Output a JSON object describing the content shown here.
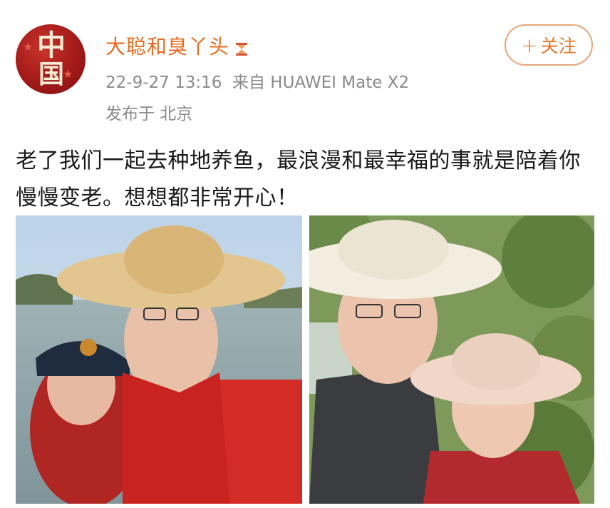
{
  "post": {
    "username": "大聪和臭丫头",
    "timestamp": "22-9-27 13:16",
    "source": "来自 HUAWEI Mate X2",
    "location": "发布于 北京",
    "follow_label": "关注",
    "text": "老了我们一起去种地养鱼，最浪漫和最幸福的事就是陪着你慢慢变老。想想都非常开心！"
  },
  "icons": {
    "avatar": "avatar-logo",
    "badge": "hourglass-badge-icon",
    "follow": "plus-icon"
  },
  "colors": {
    "username": "#ea6a1f",
    "meta": "#8a8a8a",
    "follow_border": "#e7a57a",
    "avatar_red": "#a31a18"
  }
}
